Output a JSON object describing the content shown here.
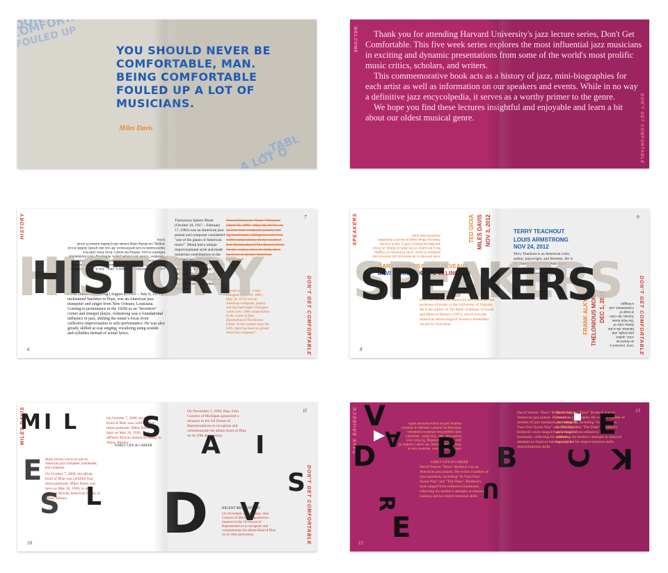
{
  "spread1": {
    "quote": "YOU SHOULD NEVER BE COMFORTABLE, MAN. BEING COMFORTABLE FOULED UP A LOT OF MUSICIANS.",
    "attribution": "Miles Davis",
    "bg_words": [
      "DON'T GET",
      "COMFORTABLE",
      "FOULED UP",
      "…TABL",
      "A LOT O"
    ],
    "colors": {
      "bg": "#d9d6cd",
      "quote": "#1f5bb5",
      "attribution": "#e8862c"
    }
  },
  "spread2": {
    "paragraphs": [
      "Thank you for attending Harvard University's jazz lecture series, Don't Get Comfortable. This five week series explores the most influential jazz musicians in exciting and dynamic presentations from some of the world's most prolific music critics, scholars, and writers.",
      "This commemorative book acts as a history of jazz, mini-biographies for each artist as well as information on our speakers and events. While in no way a definitive jazz encycolpedia, it serves as a worthy primer to the genre.",
      "We hope you find these lectures insightful and enjoyable and learn a bit about our oldest musical genre."
    ],
    "side_left": "WELCOME",
    "side_right": "DON'T GET COMFORTABLE",
    "colors": {
      "bg": "#b02a6a"
    }
  },
  "spread3": {
    "big_word": "HISTORY",
    "side_left": "HISTORY",
    "side_right": "DON'T GET COMFORTABLE",
    "page_left": "6",
    "page_right": "7",
    "text_monk": "Thelonious Sphere Monk (October 10, 1917 – February 17, 1982) was an American jazz pianist and composer considered \"one of the giants of American music\". Monk had a unique improvisational style and made numerous contributions to the standard jazz repertoire, including \"Epistrophy\", \"'Round Midnight\", \"Blue Monk\", \"Straight, No Chaser\" and \"Well, You Needn't\". Monk is the second-most recorded jazz composer",
    "text_ellington": "Edward Kennedy \"Duke\" Ellington (April 29, 1899 – May 24, 1974) was an American composer, pianist, and big band leader. Ellington wrote over 1,000 compositions. In the words of Bob Blumenthal of The Boston Globe \"in the century since his birth, there has been no greater American composer.\"",
    "text_armstrong": "Louis Daniel Armstrong (August 4, 1901 – July 6, 1971), nicknamed Satchmo or Pops, was an American jazz trumpeter and singer from New Orleans, Louisiana. Coming to prominence in the 1920s as an \"inventive\" cornet and trumpet player, Armstrong was a foundational influence in jazz, shifting the music's focus from collective improvisation to solo performance. He was also greatly skilled at scat singing, vocalizing using sounds and syllables instead of actual lyrics."
  },
  "spread4": {
    "big_word": "SPEAKERS",
    "side_left": "SPEAKERS",
    "side_right": "DON'T GET COMFORTABLE",
    "page_left": "8",
    "page_right": "9",
    "gary_giddens": "GARY GIDDENS",
    "dave_brubeck": "DAVE BRUBECK",
    "scott_deveaux": "SCOTT DEVEAUX",
    "duke_ellington": "DUKE ELLINGTON",
    "ted_gioia": "TED GIOIA",
    "miles_davis": "MILES DAVIS",
    "date_nov3": "NOV 3, 2012",
    "terry_teachout": "TERRY TEACHOUT",
    "louis_armstrong": "LOUIS ARMSTRONG",
    "date_nov24": "NOV 24, 2012",
    "frank_alkyer": "FRANK ALKYER",
    "thelonious_monk": "THELONIOUS MONK",
    "date_dec1": "DEC 1, 2012",
    "text_deveaux": "Scott DeVeaux is an American jazz historian and professor of music at the University of Virginia. He is the author of The Birth of Bebop: A Social and Musical History (1997), which won the American Musicological Society's Kinkeldey Award for best book.",
    "text_teachout": "Terry Teachout is an American critic, author, playwright, and librettist. He is the drama critic of The Wall Street Journal, the critic-at-large of Commentary, and a blogger."
  },
  "spread5": {
    "big_letters": [
      "M",
      "I",
      "L",
      "E",
      "S",
      "D",
      "A",
      "V",
      "I",
      "S"
    ],
    "side_left": "MILES DAVIS",
    "side_right": "DON'T GET COMFORTABLE",
    "page_left": "10",
    "page_right": "11",
    "heading_early": "EARLY LIFE & CAREER",
    "heading_recent": "RECENT RECOGNITION",
    "text_intro": "Miles Dewey Davis III was an American jazz trumpeter, bandleader, and composer.",
    "text_birth": "On October 7, 2008, his album Kind of Blue was certified four times platinum. Miles Davis was born on May 26, 1926, to an affluent African American family in Alton, Illinois.",
    "text_recent": "On November 5, 2009, Rep. John Conyers of Michigan sponsored a measure in the US House of Representatives to recognize and commemorate the album Kind of Blue on its 50th anniversary."
  },
  "spread6": {
    "big_letters": [
      "D",
      "A",
      "V",
      "E",
      "B",
      "R",
      "U",
      "B",
      "E",
      "C",
      "K"
    ],
    "side_left": "DAVE BRUBECK",
    "page_left": "12",
    "page_right": "13",
    "heading_early": "EARLY LIFE & CAREER",
    "text_col": "David Warren \"Dave\" Brubeck was an American jazz pianist. He wrote a number of jazz standards, including \"In Your Own Sweet Way\" and \"The Duke\". Brubeck's style ranged from refined to bombastic, reflecting his mother's attempts at classical training and his improvisational skills.",
    "colors": {
      "bg": "#a8286a"
    }
  }
}
